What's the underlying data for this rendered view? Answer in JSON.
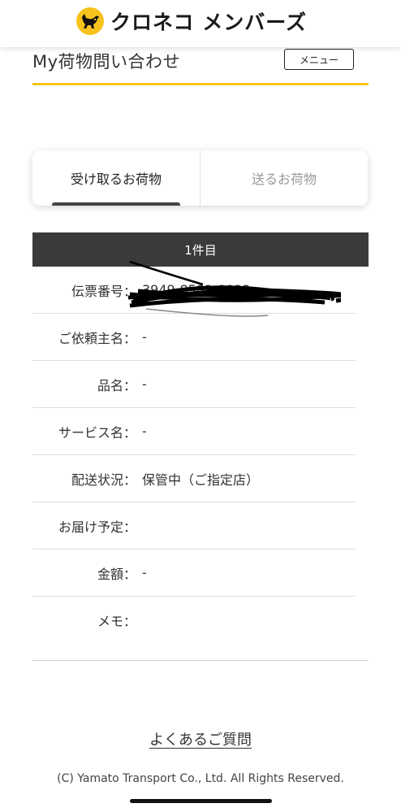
{
  "header": {
    "brand_name": "クロネコ メンバーズ",
    "logo_icon": "black-cat-logo-icon",
    "brand_color": "#f7c21b"
  },
  "page": {
    "title": "My荷物問い合わせ",
    "menu_label": "メニュー",
    "accent_color": "#f5c518"
  },
  "tabs": [
    {
      "label": "受け取るお荷物",
      "active": true
    },
    {
      "label": "送るお荷物",
      "active": false
    }
  ],
  "card": {
    "header": "1件目",
    "rows": [
      {
        "label": "伝票番号：",
        "value": "3949-8582-8022",
        "redacted": true
      },
      {
        "label": "ご依頼主名：",
        "value": "-"
      },
      {
        "label": "品名：",
        "value": "-"
      },
      {
        "label": "サービス名：",
        "value": "-"
      },
      {
        "label": "配送状況：",
        "value": "保管中（ご指定店）"
      },
      {
        "label": "お届け予定：",
        "value": ""
      },
      {
        "label": "金額：",
        "value": "-"
      },
      {
        "label": "メモ：",
        "value": ""
      }
    ]
  },
  "footer": {
    "faq_link": "よくあるご質問",
    "copyright": "(C) Yamato Transport Co., Ltd. All Rights Reserved."
  }
}
